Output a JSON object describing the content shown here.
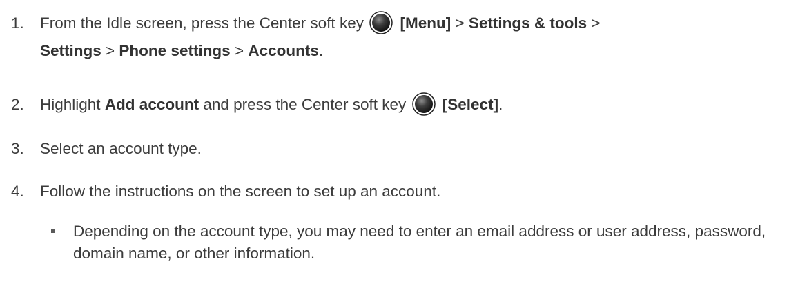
{
  "steps": [
    {
      "number": "1.",
      "line1": {
        "t1": "From the Idle screen, press the Center soft key",
        "key_label": "[Menu]",
        "sep1": " > ",
        "b1": "Settings & tools",
        "sep2": " >"
      },
      "line2": {
        "b2": "Settings",
        "sep3": " > ",
        "b3": "Phone settings",
        "sep4": " > ",
        "b4": "Accounts",
        "end": "."
      }
    },
    {
      "number": "2.",
      "t1": "Highlight ",
      "b1": "Add account",
      "t2": " and press the Center soft key",
      "key_label": "[Select]",
      "end": "."
    },
    {
      "number": "3.",
      "text": "Select an account type."
    },
    {
      "number": "4.",
      "text": "Follow the instructions on the screen to set up an account."
    }
  ],
  "bullet": {
    "text": "Depending on the account type, you may need to enter an email address or user address, password, domain name, or other information."
  },
  "icons": {
    "center_soft_key": "center-soft-key-icon"
  }
}
